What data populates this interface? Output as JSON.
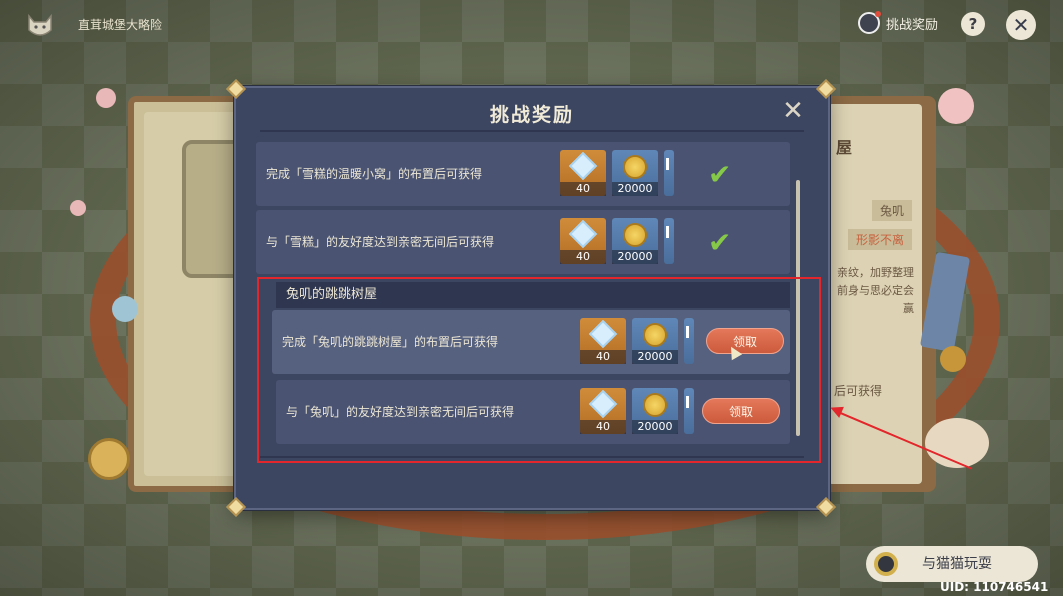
{
  "topbar": {
    "title": "直茸城堡大略险",
    "challenge_reward_label": "挑战奖励",
    "help_label": "?",
    "close_label": "✕"
  },
  "background_book": {
    "right_page_title": "屋",
    "character_name": "兔叽",
    "tag": "形影不离",
    "description": "亲纹，加野整理前身与思必定会赢",
    "obtain_text": "后可获得"
  },
  "modal": {
    "title": "挑战奖励",
    "close_label": "✕",
    "rows_top": [
      {
        "text": "完成「雪糕的温暖小窝」的布置后可获得",
        "rewards": [
          {
            "icon": "star-gem-icon",
            "qty": "40"
          },
          {
            "icon": "gold-coin-icon",
            "qty": "20000"
          }
        ],
        "status": "claimed"
      },
      {
        "text": "与「雪糕」的友好度达到亲密无间后可获得",
        "rewards": [
          {
            "icon": "star-gem-icon",
            "qty": "40"
          },
          {
            "icon": "gold-coin-icon",
            "qty": "20000"
          }
        ],
        "status": "claimed"
      }
    ],
    "section": {
      "title": "兔叽的跳跳树屋",
      "rows": [
        {
          "text": "完成「兔叽的跳跳树屋」的布置后可获得",
          "rewards": [
            {
              "icon": "star-gem-icon",
              "qty": "40"
            },
            {
              "icon": "gold-coin-icon",
              "qty": "20000"
            }
          ],
          "button": "领取"
        },
        {
          "text": "与「兔叽」的友好度达到亲密无间后可获得",
          "rewards": [
            {
              "icon": "star-gem-icon",
              "qty": "40"
            },
            {
              "icon": "gold-coin-icon",
              "qty": "20000"
            }
          ],
          "button": "领取"
        }
      ]
    }
  },
  "bottom": {
    "play_button": "与猫猫玩耍",
    "uid": "UID: 110746541"
  },
  "colors": {
    "modal_bg": "#3d4660",
    "claim_button": "#d8654a",
    "check": "#86c847",
    "highlight": "#e2262b"
  }
}
